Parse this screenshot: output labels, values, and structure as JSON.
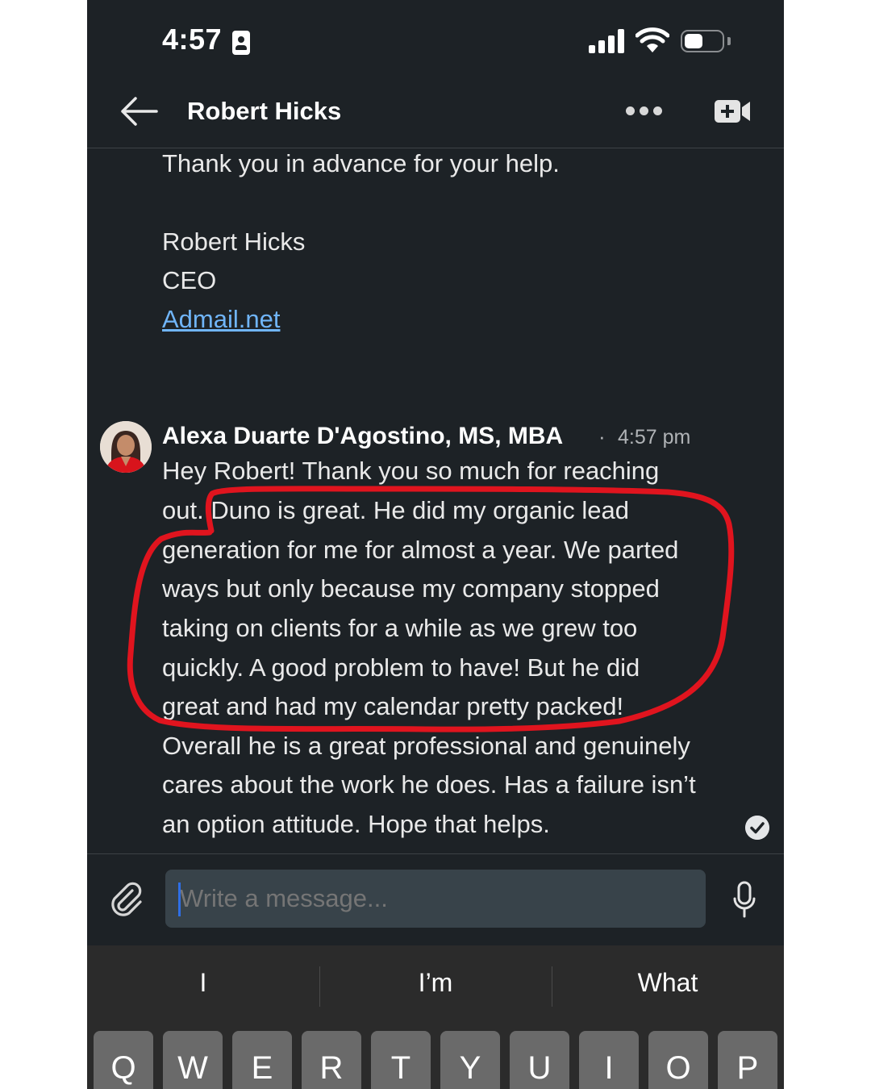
{
  "status_bar": {
    "time": "4:57"
  },
  "header": {
    "title": "Robert Hicks"
  },
  "previous_message": {
    "lines": [
      "Thank you in advance for your help.",
      "Robert Hicks",
      "CEO"
    ],
    "link": "Admail.net"
  },
  "message": {
    "sender": "Alexa Duarte D'Agostino, MS, MBA",
    "separator": "·",
    "time": "4:57 pm",
    "lines": [
      "Hey Robert! Thank you so much for reaching",
      "out. Duno is great. He did my organic lead",
      "generation for me for almost a year. We parted",
      "ways but only because my company stopped",
      "taking on clients for a while as we grew too",
      "quickly. A good problem to have! But he did",
      "great and had my calendar pretty packed!",
      "Overall he is a great professional and genuinely",
      "cares about the work he does. Has a failure isn’t",
      "an option attitude. Hope that helps."
    ]
  },
  "composer": {
    "placeholder": "Write a message..."
  },
  "keyboard": {
    "suggestions": [
      "I",
      "I’m",
      "What"
    ],
    "keys": [
      "Q",
      "W",
      "E",
      "R",
      "T",
      "Y",
      "U",
      "I",
      "O",
      "P"
    ]
  },
  "colors": {
    "background": "#1d2226",
    "link": "#70b5f9",
    "annotation": "#e0141e",
    "caret": "#2f6fe6"
  }
}
